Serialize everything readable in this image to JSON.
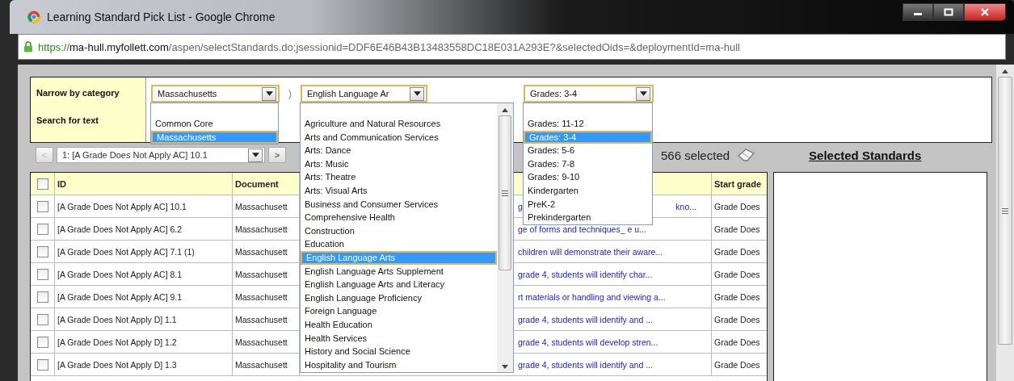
{
  "window": {
    "title": "Learning Standard Pick List - Google Chrome"
  },
  "address_bar": {
    "scheme": "https://",
    "host": "ma-hull.myfollett.com",
    "path": "/aspen/selectStandards.do;jsessionid=DDF6E46B43B13483558DC18E031A293E?&selectedOids=&deploymentId=ma-hull"
  },
  "filters": {
    "narrow_label": "Narrow by category",
    "search_label": "Search for text",
    "separator": ")",
    "selects": [
      {
        "value": "Massachusetts",
        "expanded": true,
        "options": [
          {
            "label": "Common Core",
            "selected": false
          },
          {
            "label": "Massachusetts",
            "selected": true
          }
        ]
      },
      {
        "value": "English Language Ar",
        "expanded": true,
        "options": [
          {
            "label": "Agriculture and Natural Resources",
            "selected": false
          },
          {
            "label": "Arts and Communication Services",
            "selected": false
          },
          {
            "label": "Arts: Dance",
            "selected": false
          },
          {
            "label": "Arts: Music",
            "selected": false
          },
          {
            "label": "Arts: Theatre",
            "selected": false
          },
          {
            "label": "Arts: Visual Arts",
            "selected": false
          },
          {
            "label": "Business and Consumer Services",
            "selected": false
          },
          {
            "label": "Comprehensive Health",
            "selected": false
          },
          {
            "label": "Construction",
            "selected": false
          },
          {
            "label": "Education",
            "selected": false
          },
          {
            "label": "English Language Arts",
            "selected": true
          },
          {
            "label": "English Language Arts Supplement",
            "selected": false
          },
          {
            "label": "English Language Arts and Literacy",
            "selected": false
          },
          {
            "label": "English Language Proficiency",
            "selected": false
          },
          {
            "label": "Foreign Language",
            "selected": false
          },
          {
            "label": "Health Education",
            "selected": false
          },
          {
            "label": "Health Services",
            "selected": false
          },
          {
            "label": "History and Social Science",
            "selected": false
          },
          {
            "label": "Hospitality and Tourism",
            "selected": false
          }
        ]
      },
      {
        "value": "Grades: 3-4",
        "expanded": true,
        "options": [
          {
            "label": "Grades: 11-12",
            "selected": false
          },
          {
            "label": "Grades: 3-4",
            "selected": true
          },
          {
            "label": "Grades: 5-6",
            "selected": false
          },
          {
            "label": "Grades: 7-8",
            "selected": false
          },
          {
            "label": "Grades: 9-10",
            "selected": false
          },
          {
            "label": "Kindergarten",
            "selected": false
          },
          {
            "label": "PreK-2",
            "selected": false
          },
          {
            "label": "Prekindergarten",
            "selected": false
          }
        ]
      }
    ]
  },
  "pager": {
    "prev": "<",
    "current": "1: [A Grade Does Not Apply AC] 10.1",
    "next": ">"
  },
  "selected_count": "566 selected",
  "selected_panel": {
    "title": "Selected Standards"
  },
  "table": {
    "all_checked": false,
    "columns": [
      "ID",
      "Document",
      "Start grade"
    ],
    "rows": [
      {
        "checked": false,
        "id": "[A Grade Does Not Apply AC] 10.1",
        "document": "Massachusett",
        "description": "g",
        "description_end": "kno...",
        "start_grade": "Grade Does"
      },
      {
        "checked": false,
        "id": "[A Grade Does Not Apply AC] 6.2",
        "document": "Massachusett",
        "description": "ge of forms and techniques_ e u...",
        "start_grade": "Grade Does"
      },
      {
        "checked": false,
        "id": "[A Grade Does Not Apply AC] 7.1 (1)",
        "document": "Massachusett",
        "description": "children will demonstrate their aware...",
        "start_grade": "Grade Does"
      },
      {
        "checked": false,
        "id": "[A Grade Does Not Apply AC] 8.1",
        "document": "Massachusett",
        "description": "grade 4, students will identify char...",
        "start_grade": "Grade Does"
      },
      {
        "checked": false,
        "id": "[A Grade Does Not Apply AC] 9.1",
        "document": "Massachusett",
        "description": "rt materials or handling and viewing a...",
        "start_grade": "Grade Does"
      },
      {
        "checked": false,
        "id": "[A Grade Does Not Apply D] 1.1",
        "document": "Massachusett",
        "description": "grade 4, students will identify and ...",
        "start_grade": "Grade Does"
      },
      {
        "checked": false,
        "id": "[A Grade Does Not Apply D] 1.2",
        "document": "Massachusett",
        "description": "grade 4, students will develop stren...",
        "start_grade": "Grade Does"
      },
      {
        "checked": false,
        "id": "[A Grade Does Not Apply D] 1.3",
        "document": "Massachusett",
        "description": "grade 4, students will identify and ...",
        "start_grade": "Grade Does"
      }
    ]
  }
}
